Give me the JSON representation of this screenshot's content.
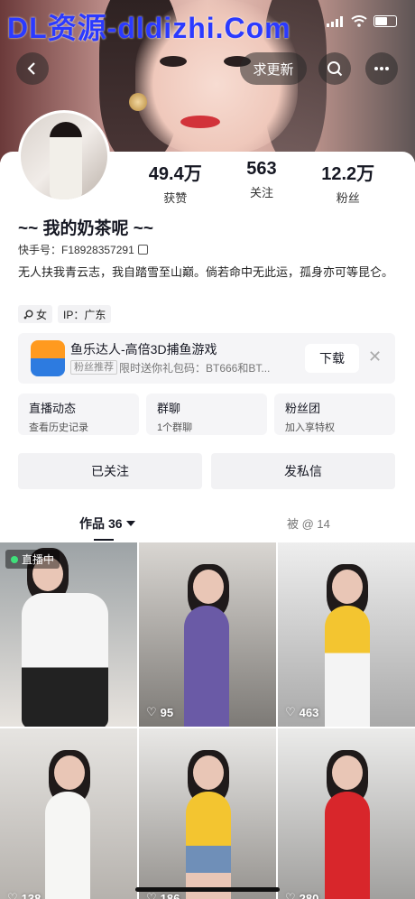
{
  "watermark": "DL资源-dldizhi.Com",
  "header": {
    "back_icon": "chevron-left-icon",
    "update_label": "求更新",
    "search_icon": "search-icon",
    "more_icon": "more-dots-icon"
  },
  "profile": {
    "stats": [
      {
        "value": "49.4万",
        "label": "获赞"
      },
      {
        "value": "563",
        "label": "关注"
      },
      {
        "value": "12.2万",
        "label": "粉丝"
      }
    ],
    "name": "~~ 我的奶茶呢 ~~",
    "kuaishou_id": "快手号：F18928357291",
    "bio": "无人扶我青云志，我自踏雪至山巅。倘若命中无此运，孤身亦可等昆仑。",
    "tags": [
      "女",
      "IP：广东"
    ]
  },
  "promo": {
    "title": "鱼乐达人-高倍3D捕鱼游戏",
    "badge": "粉丝推荐",
    "subtitle": "限时送你礼包码：BT666和BT...",
    "download_label": "下载",
    "close_label": "✕"
  },
  "features": [
    {
      "title": "直播动态",
      "subtitle": "查看历史记录"
    },
    {
      "title": "群聊",
      "subtitle": "1个群聊"
    },
    {
      "title": "粉丝团",
      "subtitle": "加入享特权"
    }
  ],
  "actions": {
    "followed": "已关注",
    "message": "发私信"
  },
  "tabs": {
    "works_label": "作品",
    "works_count": "36",
    "mentions": "被 @ 14"
  },
  "grid": [
    {
      "live": "直播中",
      "likes": ""
    },
    {
      "live": "",
      "likes": "95"
    },
    {
      "live": "",
      "likes": "463"
    },
    {
      "live": "",
      "likes": "138"
    },
    {
      "live": "",
      "likes": "186"
    },
    {
      "live": "",
      "likes": "280"
    }
  ],
  "colors": {
    "accent": "#161823",
    "watermark": "#2b3aff",
    "live_dot": "#3fe07a"
  }
}
